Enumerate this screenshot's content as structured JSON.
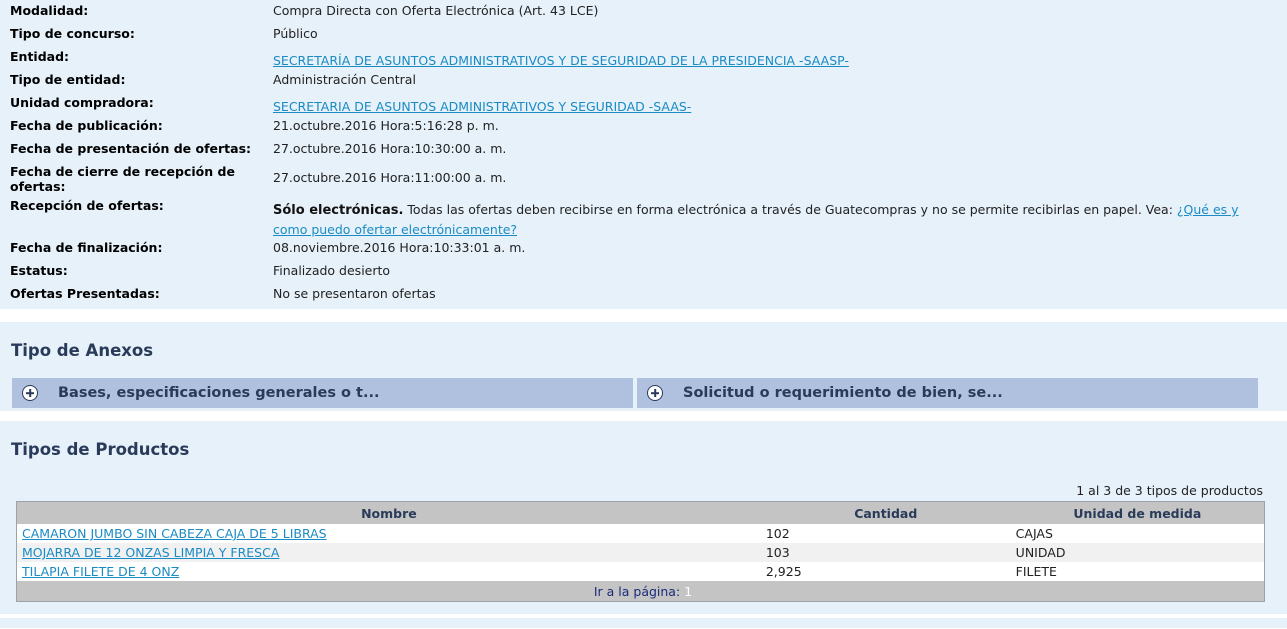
{
  "details": [
    {
      "label": "Modalidad:",
      "value": "Compra Directa con Oferta Electrónica (Art. 43 LCE)"
    },
    {
      "label": "Tipo de concurso:",
      "value": "Público"
    },
    {
      "label": "Entidad:",
      "value": "SECRETARÍA DE ASUNTOS ADMINISTRATIVOS Y DE SEGURIDAD DE LA PRESIDENCIA -SAASP-"
    },
    {
      "label": "Tipo de entidad:",
      "value": "Administración Central"
    },
    {
      "label": "Unidad compradora:",
      "value": "SECRETARIA DE ASUNTOS ADMINISTRATIVOS Y SEGURIDAD -SAAS-"
    },
    {
      "label": "Fecha de publicación:",
      "value": "21.octubre.2016 Hora:5:16:28 p. m."
    },
    {
      "label": "Fecha de presentación de ofertas:",
      "value": "27.octubre.2016 Hora:10:30:00 a. m."
    },
    {
      "label": "Fecha de cierre de recepción de ofertas:",
      "value": "27.octubre.2016 Hora:11:00:00 a. m."
    },
    {
      "label": "Recepción de ofertas:",
      "lead": "Sólo electrónicas.",
      "value": " Todas las ofertas deben recibirse en forma electrónica a través de Guatecompras y no se permite recibirlas en papel. Vea: ",
      "link": "¿Qué es y como puedo ofertar electrónicamente?"
    },
    {
      "label": "Fecha de finalización:",
      "value": "08.noviembre.2016 Hora:10:33:01 a. m."
    },
    {
      "label": "Estatus:",
      "value": "Finalizado desierto"
    },
    {
      "label": "Ofertas Presentadas:",
      "value": "No se presentaron ofertas"
    }
  ],
  "annexes": {
    "title": "Tipo de Anexos",
    "items": [
      {
        "label": "Bases, especificaciones generales o t..."
      },
      {
        "label": "Solicitud o requerimiento de bien, se..."
      }
    ]
  },
  "products": {
    "title": "Tipos de Productos",
    "counter": "1 al 3 de 3 tipos de productos",
    "columns": [
      "Nombre",
      "Cantidad",
      "Unidad de medida"
    ],
    "rows": [
      {
        "name": "CAMARON JUMBO SIN CABEZA CAJA DE 5 LIBRAS",
        "qty": "102",
        "unit": "CAJAS"
      },
      {
        "name": "MOJARRA DE 12 ONZAS LIMPIA Y FRESCA",
        "qty": "103",
        "unit": "UNIDAD"
      },
      {
        "name": "TILAPIA FILETE DE 4 ONZ",
        "qty": "2,925",
        "unit": "FILETE"
      }
    ],
    "pager_label": "Ir a la página:",
    "pager_page": "1"
  }
}
